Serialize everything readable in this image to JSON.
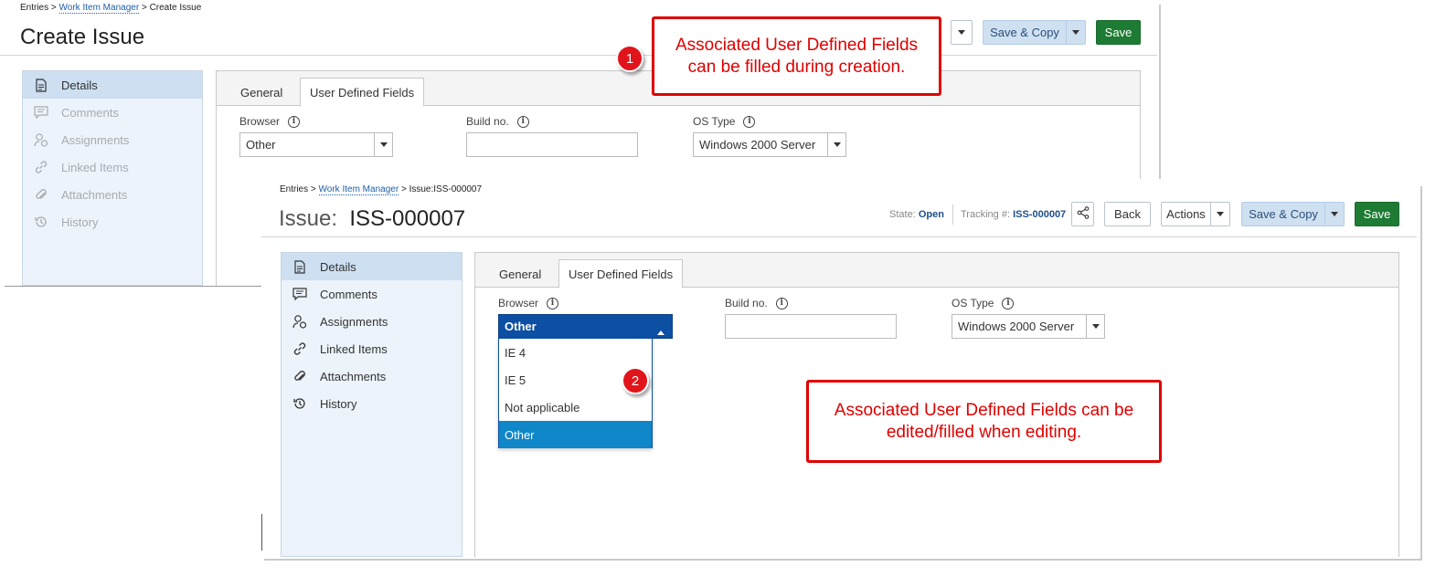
{
  "create": {
    "breadcrumb": {
      "root": "Entries",
      "sep1": ">",
      "link": "Work Item Manager",
      "sep2": ">",
      "current": "Create Issue"
    },
    "title": "Create Issue",
    "buttons": {
      "save_copy": "Save & Copy",
      "save": "Save"
    },
    "sidebar": [
      {
        "label": "Details",
        "icon": "document-icon"
      },
      {
        "label": "Comments",
        "icon": "comment-icon"
      },
      {
        "label": "Assignments",
        "icon": "user-assign-icon"
      },
      {
        "label": "Linked Items",
        "icon": "link-icon"
      },
      {
        "label": "Attachments",
        "icon": "paperclip-icon"
      },
      {
        "label": "History",
        "icon": "history-icon"
      }
    ],
    "tabs": {
      "general": "General",
      "udf": "User Defined Fields"
    },
    "fields": {
      "browser_label": "Browser",
      "browser_value": "Other",
      "build_label": "Build no.",
      "build_value": "",
      "os_label": "OS Type",
      "os_value": "Windows 2000 Server"
    }
  },
  "edit": {
    "breadcrumb": {
      "root": "Entries",
      "sep1": ">",
      "link": "Work Item Manager",
      "sep2": ">",
      "current": "Issue:ISS-000007"
    },
    "title_label": "Issue:",
    "title_id": "ISS-000007",
    "state_label": "State:",
    "state_value": "Open",
    "tracking_label": "Tracking #:",
    "tracking_value": "ISS-000007",
    "buttons": {
      "back": "Back",
      "actions": "Actions",
      "save_copy": "Save & Copy",
      "save": "Save"
    },
    "sidebar": [
      {
        "label": "Details",
        "icon": "document-icon"
      },
      {
        "label": "Comments",
        "icon": "comment-icon"
      },
      {
        "label": "Assignments",
        "icon": "user-assign-icon"
      },
      {
        "label": "Linked Items",
        "icon": "link-icon"
      },
      {
        "label": "Attachments",
        "icon": "paperclip-icon"
      },
      {
        "label": "History",
        "icon": "history-icon"
      }
    ],
    "tabs": {
      "general": "General",
      "udf": "User Defined Fields"
    },
    "fields": {
      "browser_label": "Browser",
      "browser_value": "Other",
      "build_label": "Build no.",
      "build_value": "",
      "os_label": "OS Type",
      "os_value": "Windows 2000 Server"
    },
    "browser_options": [
      "IE 4",
      "IE 5",
      "Not applicable",
      "Other"
    ]
  },
  "callouts": {
    "one": {
      "badge": "1",
      "text_line1": "Associated User Defined Fields",
      "text_line2": "can be filled during creation."
    },
    "two": {
      "badge": "2",
      "text_line1": "Associated User Defined Fields can be",
      "text_line2": "edited/filled when editing."
    }
  },
  "colors": {
    "save_green": "#1e7b34",
    "callout_red": "#e00000",
    "dropdown_highlight": "#0f87c9",
    "select_open_blue": "#0d4fa3"
  }
}
